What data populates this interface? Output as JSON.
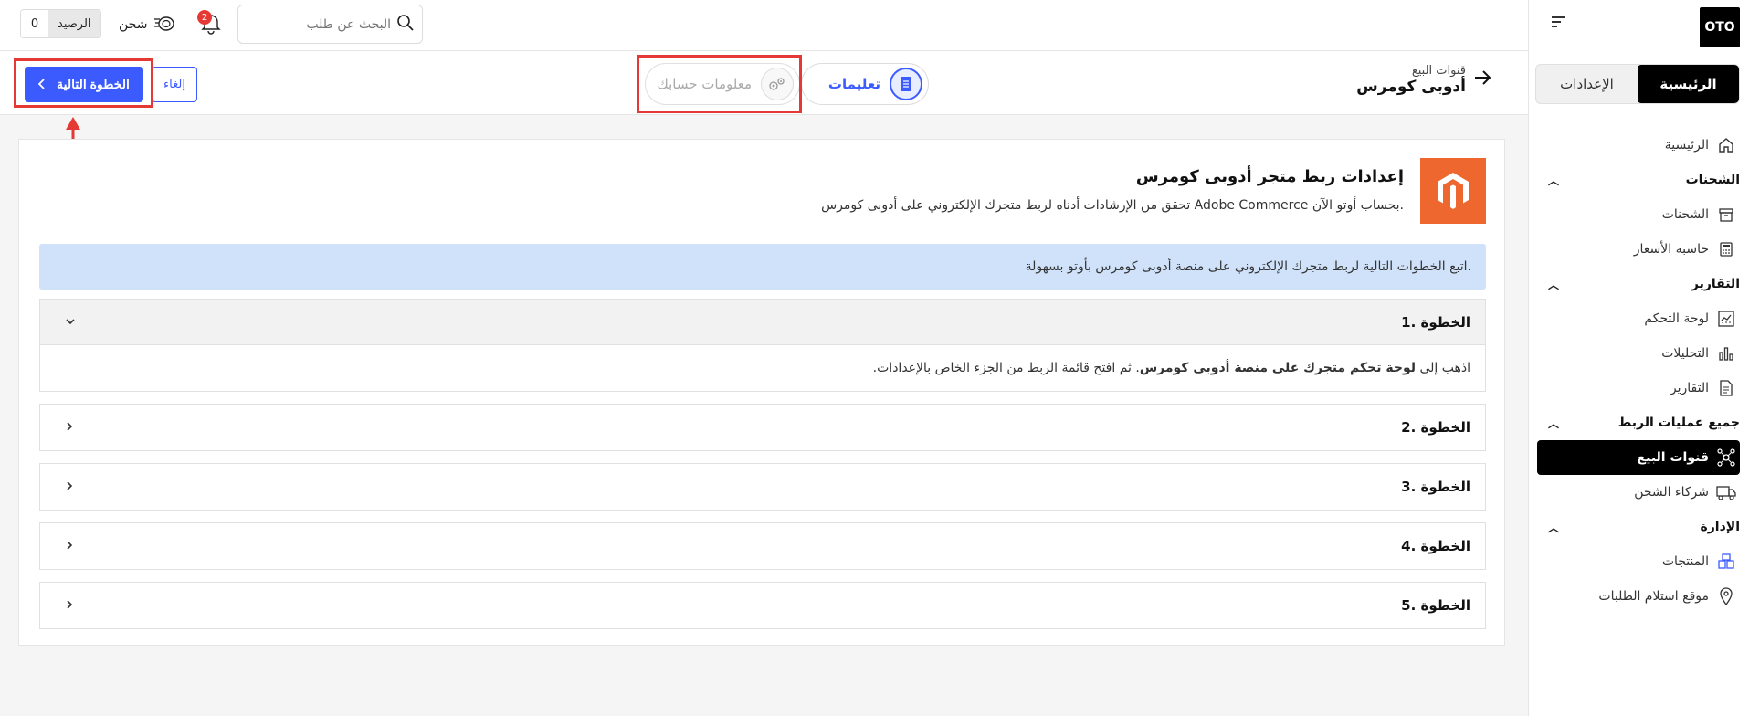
{
  "sidebar": {
    "logo": "OTO",
    "tabs": [
      {
        "label": "الرئيسية",
        "active": true
      },
      {
        "label": "الإعدادات",
        "active": false
      }
    ],
    "items": [
      {
        "label": "الرئيسية",
        "icon": "home-icon"
      },
      {
        "label": "الشحنات",
        "icon": "box-icon"
      },
      {
        "label": "حاسبة الأسعار",
        "icon": "calculator-icon"
      },
      {
        "label": "لوحة التحكم",
        "icon": "dashboard-icon"
      },
      {
        "label": "التحليلات",
        "icon": "analytics-icon"
      },
      {
        "label": "التقارير",
        "icon": "report-icon"
      },
      {
        "label": "قنوات البيع",
        "icon": "network-icon"
      },
      {
        "label": "شركاء الشحن",
        "icon": "truck-icon"
      },
      {
        "label": "المنتجات",
        "icon": "products-icon"
      },
      {
        "label": "موقع استلام الطلبات",
        "icon": "location-pin-icon"
      }
    ],
    "sections": {
      "shipments": "الشحنات",
      "reports": "التقارير",
      "integrations": "جميع عمليات الربط",
      "management": "الإدارة"
    }
  },
  "topbar": {
    "balance_label": "الرصيد",
    "balance_value": "0",
    "ship_label": "شحن",
    "notifications_count": "2",
    "search_placeholder": "البحث عن طلب"
  },
  "subbar": {
    "breadcrumb_parent": "قنوات البيع",
    "breadcrumb_title": "أدوبی کومرس",
    "steps": [
      {
        "label": "تعليمات",
        "active": true
      },
      {
        "label": "معلومات حسابك",
        "active": false
      }
    ],
    "cancel_label": "إلغاء",
    "next_label": "الخطوة التالية"
  },
  "card": {
    "title": "إعدادات ربط متجر أدوبی کومرس",
    "subtitle": "تحقق من الإرشادات أدناه لربط متجرك الإلكتروني على أدوبی کومرس Adobe Commerce بحساب أوتو الآن.",
    "info": "اتبع الخطوات التالية لربط متجرك الإلكتروني على منصة أدوبی کومرس بأوتو بسهولة.",
    "steps": [
      {
        "label": "1. الخطوة",
        "open": true
      },
      {
        "label": "2. الخطوة",
        "open": false
      },
      {
        "label": "3. الخطوة",
        "open": false
      },
      {
        "label": "4. الخطوة",
        "open": false
      },
      {
        "label": "5. الخطوة",
        "open": false
      }
    ],
    "step1_body_prefix": "اذهب إلى ",
    "step1_body_bold": "لوحة تحكم متجرك على منصة أدوبی کومرس",
    "step1_body_suffix": ". ثم افتح قائمة الربط من الجزء الخاص بالإعدادات."
  },
  "colors": {
    "primary": "#3b5bff",
    "annotation_red": "#e53935",
    "magento_orange": "#ee672f",
    "info_bg": "#cfe2fa"
  }
}
